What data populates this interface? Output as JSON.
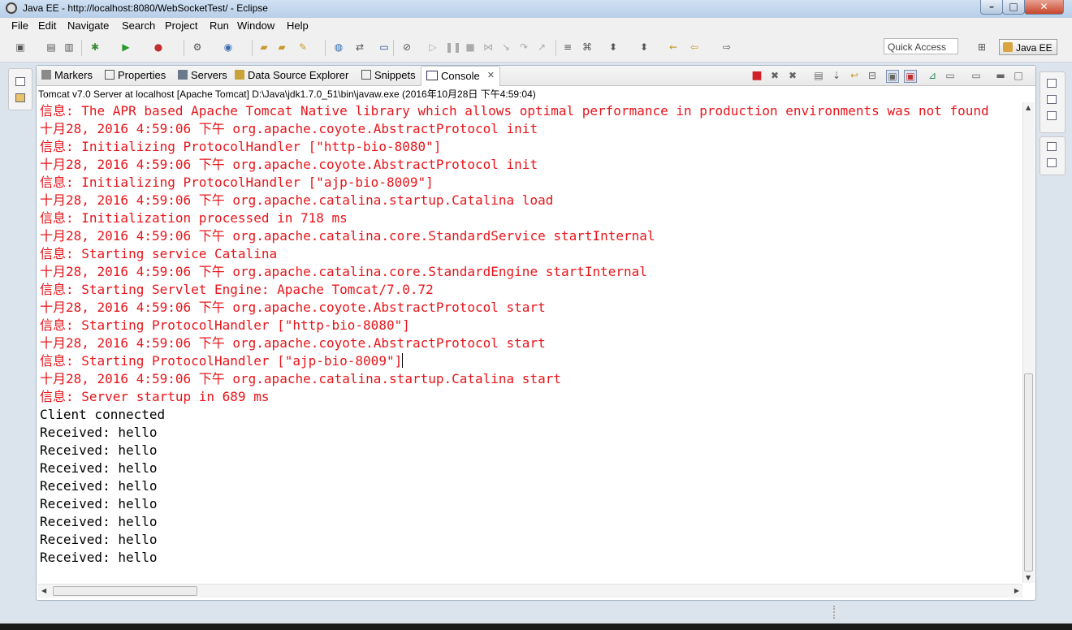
{
  "window": {
    "title": "Java EE - http://localhost:8080/WebSocketTest/ - Eclipse",
    "minimize": "–",
    "maximize": "□",
    "close": "✕"
  },
  "menubar": {
    "items": [
      "File",
      "Edit",
      "Navigate",
      "Search",
      "Project",
      "Run",
      "Window",
      "Help"
    ]
  },
  "toolbar": {
    "quick_access": "Quick Access",
    "perspective": "Java EE"
  },
  "tabs": [
    {
      "label": "Markers",
      "icon": "markers-icon"
    },
    {
      "label": "Properties",
      "icon": "properties-icon"
    },
    {
      "label": "Servers",
      "icon": "servers-icon"
    },
    {
      "label": "Data Source Explorer",
      "icon": "data-source-icon"
    },
    {
      "label": "Snippets",
      "icon": "snippets-icon"
    }
  ],
  "active_tab": {
    "label": "Console",
    "icon": "console-icon",
    "close": "✕"
  },
  "console": {
    "descriptor": "Tomcat v7.0 Server at localhost [Apache Tomcat] D:\\Java\\jdk1.7.0_51\\bin\\javaw.exe (2016年10月28日 下午4:59:04)",
    "lines": [
      {
        "text": "信息: The APR based Apache Tomcat Native library which allows optimal performance in production environments was not found",
        "stream": "err"
      },
      {
        "text": "十月28, 2016 4:59:06 下午 org.apache.coyote.AbstractProtocol init",
        "stream": "err"
      },
      {
        "text": "信息: Initializing ProtocolHandler [\"http-bio-8080\"]",
        "stream": "err"
      },
      {
        "text": "十月28, 2016 4:59:06 下午 org.apache.coyote.AbstractProtocol init",
        "stream": "err"
      },
      {
        "text": "信息: Initializing ProtocolHandler [\"ajp-bio-8009\"]",
        "stream": "err"
      },
      {
        "text": "十月28, 2016 4:59:06 下午 org.apache.catalina.startup.Catalina load",
        "stream": "err"
      },
      {
        "text": "信息: Initialization processed in 718 ms",
        "stream": "err"
      },
      {
        "text": "十月28, 2016 4:59:06 下午 org.apache.catalina.core.StandardService startInternal",
        "stream": "err"
      },
      {
        "text": "信息: Starting service Catalina",
        "stream": "err"
      },
      {
        "text": "十月28, 2016 4:59:06 下午 org.apache.catalina.core.StandardEngine startInternal",
        "stream": "err"
      },
      {
        "text": "信息: Starting Servlet Engine: Apache Tomcat/7.0.72",
        "stream": "err"
      },
      {
        "text": "十月28, 2016 4:59:06 下午 org.apache.coyote.AbstractProtocol start",
        "stream": "err"
      },
      {
        "text": "信息: Starting ProtocolHandler [\"http-bio-8080\"]",
        "stream": "err"
      },
      {
        "text": "十月28, 2016 4:59:06 下午 org.apache.coyote.AbstractProtocol start",
        "stream": "err"
      },
      {
        "text": "信息: Starting ProtocolHandler [\"ajp-bio-8009\"]",
        "stream": "err",
        "caret": true
      },
      {
        "text": "十月28, 2016 4:59:06 下午 org.apache.catalina.startup.Catalina start",
        "stream": "err"
      },
      {
        "text": "信息: Server startup in 689 ms",
        "stream": "err"
      },
      {
        "text": "Client connected",
        "stream": "out"
      },
      {
        "text": "Received: hello",
        "stream": "out"
      },
      {
        "text": "Received: hello",
        "stream": "out"
      },
      {
        "text": "Received: hello",
        "stream": "out"
      },
      {
        "text": "Received: hello",
        "stream": "out"
      },
      {
        "text": "Received: hello",
        "stream": "out"
      },
      {
        "text": "Received: hello",
        "stream": "out"
      },
      {
        "text": "Received: hello",
        "stream": "out"
      },
      {
        "text": "Received: hello",
        "stream": "out"
      }
    ]
  },
  "colors": {
    "stderr": "#e8141a",
    "stdout": "#000000"
  }
}
